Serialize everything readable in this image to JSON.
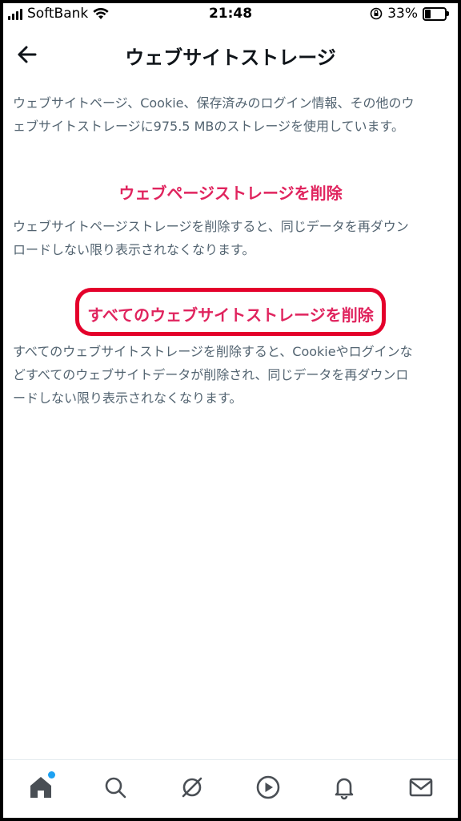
{
  "status_bar": {
    "carrier": "SoftBank",
    "time": "21:48",
    "battery_percent": "33%",
    "battery_level": 0.33
  },
  "header": {
    "title": "ウェブサイトストレージ",
    "back_icon": "arrow-left-icon"
  },
  "summary": {
    "line1": "ウェブサイトページ、Cookie、保存済みのログイン情報、その他のウ",
    "line2": "ェブサイトストレージに975.5 MBのストレージを使用しています。"
  },
  "webpage_storage": {
    "action_label": "ウェブページストレージを削除",
    "desc_line1": "ウェブサイトページストレージを削除すると、同じデータを再ダウン",
    "desc_line2": "ロードしない限り表示されなくなります。"
  },
  "all_storage": {
    "action_label": "すべてのウェブサイトストレージを削除",
    "desc_line1": "すべてのウェブサイトストレージを削除すると、Cookieやログインな",
    "desc_line2": "どすべてのウェブサイトデータが削除され、同じデータを再ダウンロ",
    "desc_line3": "ードしない限り表示されなくなります。"
  },
  "tabbar": {
    "items": [
      "home-icon",
      "search-icon",
      "spaces-icon",
      "video-icon",
      "notifications-icon",
      "messages-icon"
    ],
    "active": "home-icon"
  },
  "colors": {
    "action_red": "#e0245e",
    "annotation_red": "#e4002b",
    "secondary_text": "#536471",
    "badge_blue": "#1da1f2"
  }
}
